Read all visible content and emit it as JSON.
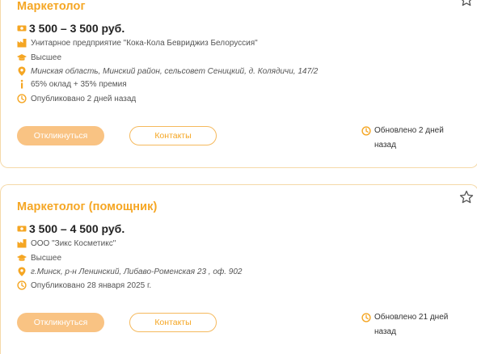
{
  "colors": {
    "accent": "#f5a623",
    "button_fill": "#f9c383",
    "border": "#f5d9a8"
  },
  "vacancies": [
    {
      "title": "Маркетолог",
      "salary": "3 500 – 3 500 руб.",
      "employer": "Унитарное предприятие \"Кока-Кола Бевриджиз Белоруссия\"",
      "education": "Высшее",
      "address": "Минская область, Минский район, сельсовет Сеницкий, д. Колядичи, 147/2",
      "note": "65% оклад + 35% премия",
      "published": "Опубликовано 2 дней назад",
      "apply_label": "Откликнуться",
      "contacts_label": "Контакты",
      "updated": "Обновлено 2 дней назад"
    },
    {
      "title": "Маркетолог (помощник)",
      "salary": "3 500 – 4 500 руб.",
      "employer": "ООО \"Зикс Косметикс\"",
      "education": "Высшее",
      "address": "г.Минск, р-н Ленинский, Либаво-Роменская 23 , оф. 902",
      "published": "Опубликовано 28 января 2025 г.",
      "apply_label": "Откликнуться",
      "contacts_label": "Контакты",
      "updated": "Обновлено 21 дней назад"
    }
  ],
  "icons": {
    "salary": "money-icon",
    "employer": "factory-icon",
    "education": "graduation-cap-icon",
    "address": "map-pin-icon",
    "note": "info-icon",
    "published": "clock-icon",
    "favorite": "star-icon"
  }
}
